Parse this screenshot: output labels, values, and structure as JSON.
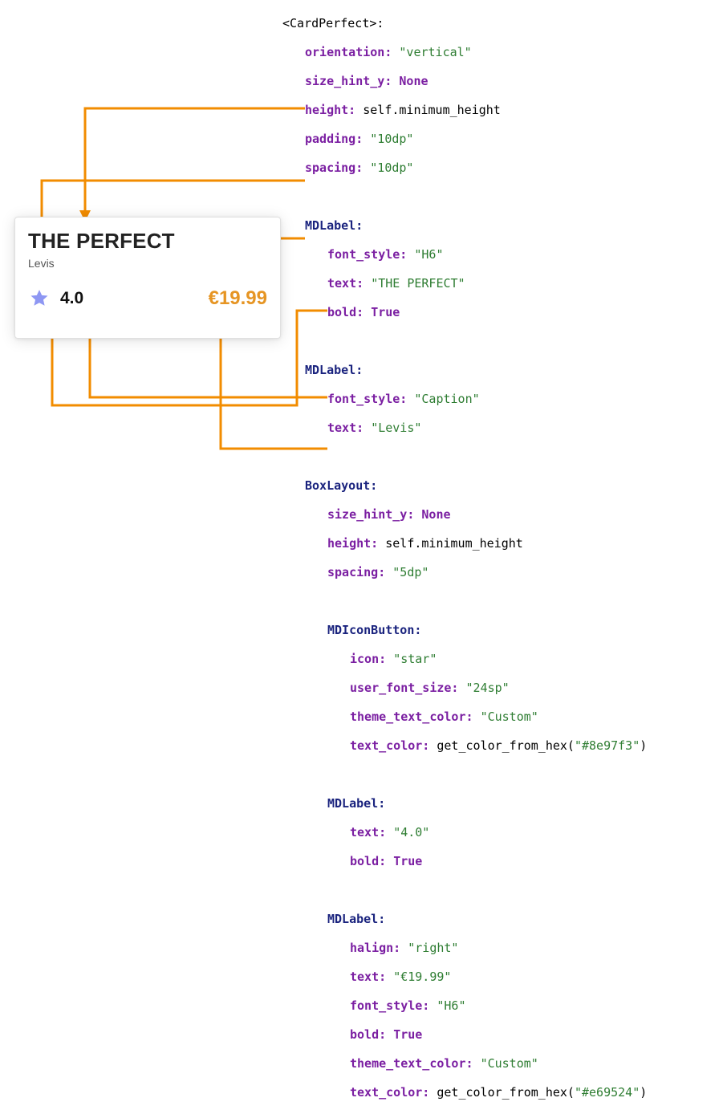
{
  "card": {
    "title": "THE PERFECT",
    "brand": "Levis",
    "rating": "4.0",
    "price": "€19.99",
    "star_color": "#8e97f3",
    "price_color": "#e69524"
  },
  "code": {
    "root": "<CardPerfect>:",
    "orientation": "\"vertical\"",
    "size_hint_y": "None",
    "root_height": "self.minimum_height",
    "padding": "\"10dp\"",
    "spacing": "\"10dp\"",
    "l1_widget": "MDLabel:",
    "l1_font_style": "\"H6\"",
    "l1_text": "\"THE PERFECT\"",
    "l1_bold": "True",
    "l2_widget": "MDLabel:",
    "l2_font_style": "\"Caption\"",
    "l2_text": "\"Levis\"",
    "box_widget": "BoxLayout:",
    "box_size_hint_y": "None",
    "box_height": "self.minimum_height",
    "box_spacing": "\"5dp\"",
    "icon_widget": "MDIconButton:",
    "icon_icon": "\"star\"",
    "icon_size": "\"24sp\"",
    "icon_theme": "\"Custom\"",
    "icon_color_fn": "get_color_from_hex(",
    "icon_color_hex": "\"#8e97f3\"",
    "l3_widget": "MDLabel:",
    "l3_text": "\"4.0\"",
    "l3_bold": "True",
    "l4_widget": "MDLabel:",
    "l4_halign": "\"right\"",
    "l4_text": "\"€19.99\"",
    "l4_font_style": "\"H6\"",
    "l4_bold": "True",
    "l4_theme": "\"Custom\"",
    "l4_color_fn": "get_color_from_hex(",
    "l4_color_hex": "\"#e69524\""
  }
}
